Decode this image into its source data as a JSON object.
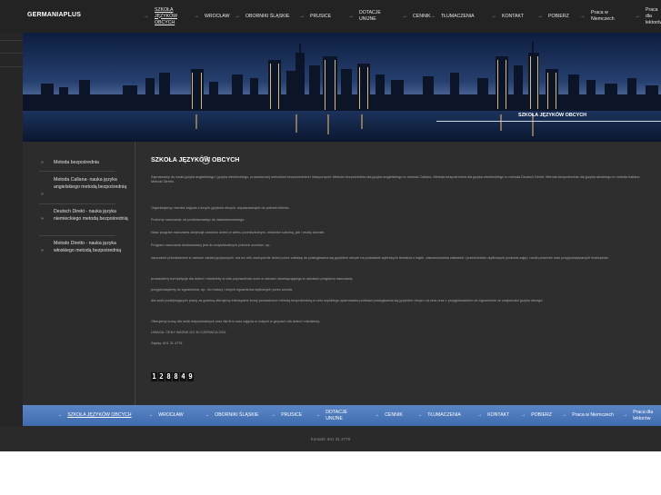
{
  "logo": "GERMANIAPLUS",
  "nav": [
    {
      "label": "SZKOŁA JĘZYKÓW OBCYCH",
      "active": true
    },
    {
      "label": "WROCŁAW"
    },
    {
      "label": "OBORNIKI ŚLĄSKIE"
    },
    {
      "label": "PRUSICE"
    },
    {
      "label": "DOTACJE UNIJNE"
    },
    {
      "label": "CENNIK"
    },
    {
      "label": "TŁUMACZENIA"
    },
    {
      "label": "KONTAKT"
    },
    {
      "label": "POBIERZ"
    },
    {
      "label": "Praca w Niemczech"
    },
    {
      "label": "Praca dla lektorów"
    }
  ],
  "banner": {
    "caption": "SZKOŁA JĘZYKÓW OBCYCH"
  },
  "sidebar": {
    "items": [
      {
        "label": "Metoda bezpośrednia"
      },
      {
        "label": "Metoda Callana- nauka języka angielskiego metodą bezpośrednią"
      },
      {
        "label": "Deutsch Direkt - nauka języka niemieckiego metodą bezpośrednią"
      },
      {
        "label": "Metodo Diretto - nauka języka włoskiego metodą bezpośrednią"
      }
    ]
  },
  "content": {
    "title": "SZKOŁA JĘZYKÓW OBCYCH",
    "paragraphs": [
      "Zapraszamy do nauki języka angielskiego i języka niemieckiego, prowadzonej metodami bezpośrednimi i klasycznymi: Metoda bezpośrednia dla języka angielskiego to metoda Callana. Metoda bezpośrednia dla języka niemieckiego to metoda Deutsch Direkt. Metoda bezpośrednia dla języka włoskiego to metoda Italiano Metodo Diretto.",
      "Organizujemy również zajęcia z innych języków obcych, dopasowanych do potrzeb klienta.",
      "Poziomy nauczania: od podstawowego do zaawansowanego.",
      "Nasz program nauczania obejmuje zarówno dzieci w wieku przedszkolnym, młodzież szkolną, jak i osoby dorosłe.",
      "Program nauczania dostosowany jest do indywidualnych potrzeb uczniów, np.:",
      "nauczanie przedszkolne w ramach zabaw językowych, ma na celu zachęcenie dzieci przez zabawę do posługiwania się językiem obcym na podstawie wybranych tematów z bajek, zaaranżowania zabawek i przedmiotów użytkowych podczas zajęć, nauki piosenek oraz przygotowywanych teatrzyków;",
      "prowadzimy korepetycje dla dzieci i młodzieży w celu poprawienia ocen w ramach obowiązującego w szkołach programu nauczania;",
      "przygotowujemy do egzaminów, np.: do matury i innych egzaminów wybranych przez ucznia;",
      "dla osób podejmujących pracę za granicą oferujemy intensywne kursy prowadzone metodą bezpośrednią w celu szybkiego opanowania podstaw posługiwania się językiem obcym od zera oraz z przygotowaniem do egzaminów ze znajomości języka obcego;",
      "Oferujemy kursy dla osób indywidualnych oraz dla firm oraz zajęcia w małych w grupach dla dzieci i młodzieży.",
      "UWAGA: CENY WAŻNE DO 30 CZERWCA 2011",
      "Zapisy: 601 31 4776"
    ],
    "counter": [
      "1",
      "2",
      "8",
      "8",
      "4",
      "9"
    ]
  },
  "bottom_nav": [
    {
      "label": "SZKOŁA JĘZYKÓW OBCYCH",
      "active": true
    },
    {
      "label": "WROCŁAW"
    },
    {
      "label": "OBORNIKI ŚLĄSKIE"
    },
    {
      "label": "PRUSICE"
    },
    {
      "label": "DOTACJE UNIJNE"
    },
    {
      "label": "CENNIK"
    },
    {
      "label": "TŁUMACZENIA"
    },
    {
      "label": "KONTAKT"
    },
    {
      "label": "POBIERZ"
    },
    {
      "label": "Praca w Niemczech"
    },
    {
      "label": "Praca dla lektorów"
    }
  ],
  "footer": {
    "text": "Kontakt: 601 31 4776"
  },
  "icons": {
    "nav_arrow": "arrow-right-icon",
    "sidebar_arrow": "double-arrow-right-icon",
    "title_icon": "check-circle-icon"
  },
  "colors": {
    "accent": "#4a78bd",
    "background": "#2e2e2e",
    "topbar": "#232323"
  }
}
